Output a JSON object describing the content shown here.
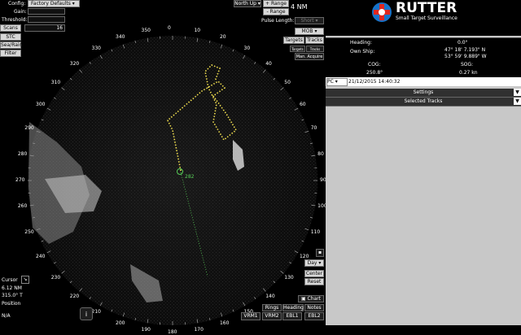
{
  "range": {
    "value": "4 NM",
    "orientation": "North Up",
    "plus": "+ Range",
    "minus": "- Range"
  },
  "pulse": {
    "label": "Pulse Length:",
    "value": "Short"
  },
  "mob": {
    "label": "MOB"
  },
  "toggles": {
    "targets": "Targets",
    "tracks": "Tracks"
  },
  "small": {
    "targets": "Targets",
    "tracks": "Tracks",
    "man_acquire": "Man. Acquire"
  },
  "left": {
    "config_label": "Config:",
    "config_value": "Factory Defaults",
    "gain_label": "Gain:",
    "threshold_label": "Threshold:",
    "scans_label": "Scans",
    "scans_value": "16",
    "stc": "STC",
    "sea_rain": "Sea/Rain",
    "filter": "Filter"
  },
  "cursor": {
    "label": "Cursor",
    "distance": "6.12 NM",
    "bearing": "315.0° T",
    "position_label": "Position",
    "position_value": "N/A"
  },
  "bearings": [
    "350",
    "0",
    "10",
    "20",
    "30",
    "40",
    "50",
    "60",
    "70",
    "80",
    "90",
    "100",
    "110",
    "120",
    "130",
    "140",
    "150",
    "160",
    "170",
    "180",
    "190",
    "200",
    "210",
    "220",
    "230",
    "240",
    "250",
    "260",
    "270",
    "280",
    "290",
    "300",
    "310",
    "320",
    "330",
    "340"
  ],
  "target_label": "282",
  "bottom_buttons": {
    "rings": "Rings",
    "heading": "Heading",
    "notes": "Notes",
    "chart": "Chart",
    "vrm1": "VRM1",
    "vrm2": "VRM2",
    "ebl1": "EBL1",
    "ebl2": "EBL2",
    "info_icon": "i"
  },
  "side_buttons": {
    "day": "Day",
    "center": "Center",
    "reset": "Reset"
  },
  "logo": {
    "name": "RUTTER",
    "tagline": "Small Target Surveillance"
  },
  "info": {
    "heading_label": "Heading:",
    "heading_value": "0.0°",
    "own_ship_label": "Own Ship:",
    "lat": "47° 18' 7.193\" N",
    "lon": "53° 59' 9.889\" W",
    "cog_label": "COG:",
    "cog_value": "250.8°",
    "sog_label": "SOG:",
    "sog_value": "0.27 kn"
  },
  "clock": {
    "source": "PC",
    "datetime": "21/12/2015 14:40:32"
  },
  "sections": {
    "settings": "Settings",
    "selected_tracks": "Selected Tracks"
  },
  "colors": {
    "track": "#f2e050",
    "target": "#58d058",
    "panel_bg": "#c8c8c8",
    "logo_blue": "#1673c9",
    "logo_red": "#e0271f"
  }
}
